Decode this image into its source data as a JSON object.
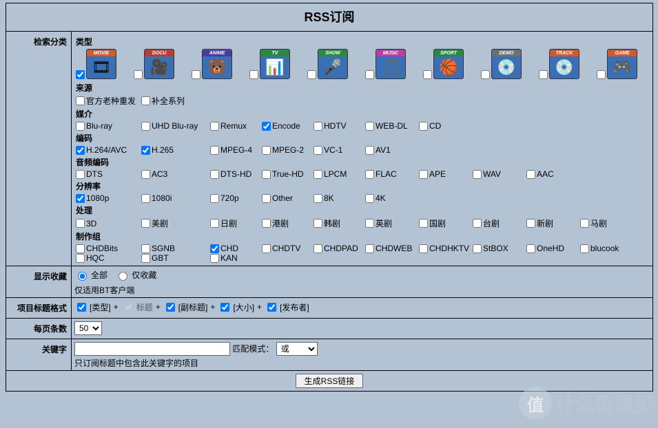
{
  "title": "RSS订阅",
  "labels": {
    "search_category": "检索分类",
    "show_favorites": "显示收藏",
    "title_format": "项目标题格式",
    "per_page": "每页条数",
    "keyword": "关键字"
  },
  "sections": {
    "type": "类型",
    "source": "来源",
    "medium": "媒介",
    "codec": "编码",
    "audio_codec": "音频编码",
    "resolution": "分辨率",
    "processing": "处理",
    "team": "制作组"
  },
  "type_icons": [
    {
      "name": "movie",
      "label": "MOVIE",
      "bg": "#3b6fb5",
      "top": "#d45a2a",
      "glyph": "🎞",
      "checked": true
    },
    {
      "name": "docu",
      "label": "DOCU",
      "bg": "#3b6fb5",
      "top": "#c13a2b",
      "glyph": "🎥",
      "gcolor": "#c13a2b",
      "checked": false
    },
    {
      "name": "anime",
      "label": "ANIME",
      "bg": "#3b6fb5",
      "top": "#4a3aa0",
      "glyph": "🐻",
      "gcolor": "#e6a53a",
      "checked": false
    },
    {
      "name": "tv",
      "label": "TV",
      "bg": "#3b6fb5",
      "top": "#2a8a3a",
      "glyph": "📊",
      "gcolor": "#2a8a3a",
      "checked": false
    },
    {
      "name": "show",
      "label": "SHOW",
      "bg": "#3b6fb5",
      "top": "#2a8a3a",
      "glyph": "🎤",
      "checked": false
    },
    {
      "name": "music",
      "label": "MUSIC",
      "bg": "#3b6fb5",
      "top": "#c43aa0",
      "glyph": "🎵",
      "gcolor": "#c43aa0",
      "checked": false
    },
    {
      "name": "sport",
      "label": "SPORT",
      "bg": "#3b6fb5",
      "top": "#2a8a3a",
      "glyph": "🏀",
      "gcolor": "#2a8a3a",
      "checked": false
    },
    {
      "name": "demo",
      "label": "DEMO",
      "bg": "#3b6fb5",
      "top": "#707070",
      "glyph": "💿",
      "checked": false
    },
    {
      "name": "track",
      "label": "TRACK",
      "bg": "#3b6fb5",
      "top": "#d45a2a",
      "glyph": "💿",
      "checked": false
    },
    {
      "name": "game",
      "label": "GAME",
      "bg": "#3b6fb5",
      "top": "#d45a2a",
      "glyph": "🎮",
      "gcolor": "#e6a53a",
      "checked": false
    }
  ],
  "source_items": [
    {
      "label": "官方老种重发",
      "checked": false
    },
    {
      "label": "补全系列",
      "checked": false
    }
  ],
  "medium_items": [
    {
      "label": "Blu-ray",
      "checked": false
    },
    {
      "label": "UHD Blu-ray",
      "checked": false
    },
    {
      "label": "Remux",
      "checked": false
    },
    {
      "label": "Encode",
      "checked": true
    },
    {
      "label": "HDTV",
      "checked": false
    },
    {
      "label": "WEB-DL",
      "checked": false
    },
    {
      "label": "CD",
      "checked": false
    }
  ],
  "codec_items": [
    {
      "label": "H.264/AVC",
      "checked": true
    },
    {
      "label": "H.265",
      "checked": true
    },
    {
      "label": "MPEG-4",
      "checked": false
    },
    {
      "label": "MPEG-2",
      "checked": false
    },
    {
      "label": "VC-1",
      "checked": false
    },
    {
      "label": "AV1",
      "checked": false
    }
  ],
  "audio_items": [
    {
      "label": "DTS",
      "checked": false
    },
    {
      "label": "AC3",
      "checked": false
    },
    {
      "label": "DTS-HD",
      "checked": false
    },
    {
      "label": "True-HD",
      "checked": false
    },
    {
      "label": "LPCM",
      "checked": false
    },
    {
      "label": "FLAC",
      "checked": false
    },
    {
      "label": "APE",
      "checked": false
    },
    {
      "label": "WAV",
      "checked": false
    },
    {
      "label": "AAC",
      "checked": false
    }
  ],
  "resolution_items": [
    {
      "label": "1080p",
      "checked": true
    },
    {
      "label": "1080i",
      "checked": false
    },
    {
      "label": "720p",
      "checked": false
    },
    {
      "label": "Other",
      "checked": false
    },
    {
      "label": "8K",
      "checked": false
    },
    {
      "label": "4K",
      "checked": false
    }
  ],
  "processing_items": [
    {
      "label": "3D",
      "checked": false
    },
    {
      "label": "美剧",
      "checked": false
    },
    {
      "label": "日剧",
      "checked": false
    },
    {
      "label": "港剧",
      "checked": false
    },
    {
      "label": "韩剧",
      "checked": false
    },
    {
      "label": "英剧",
      "checked": false
    },
    {
      "label": "国剧",
      "checked": false
    },
    {
      "label": "台剧",
      "checked": false
    },
    {
      "label": "新剧",
      "checked": false
    },
    {
      "label": "马剧",
      "checked": false
    }
  ],
  "team_items": [
    {
      "label": "CHDBits",
      "checked": false
    },
    {
      "label": "SGNB",
      "checked": false
    },
    {
      "label": "CHD",
      "checked": true
    },
    {
      "label": "CHDTV",
      "checked": false
    },
    {
      "label": "CHDPAD",
      "checked": false
    },
    {
      "label": "CHDWEB",
      "checked": false
    },
    {
      "label": "CHDHKTV",
      "checked": false
    },
    {
      "label": "StBOX",
      "checked": false
    },
    {
      "label": "OneHD",
      "checked": false
    },
    {
      "label": "blucook",
      "checked": false
    },
    {
      "label": "HQC",
      "checked": false
    },
    {
      "label": "GBT",
      "checked": false
    },
    {
      "label": "KAN",
      "checked": false
    }
  ],
  "favorites": {
    "all": "全部",
    "only": "仅收藏",
    "note": "仅适用BT客户端"
  },
  "title_format": {
    "type": {
      "label": "[类型]",
      "checked": true,
      "disabled": false
    },
    "title": {
      "label": "标题",
      "checked": true,
      "disabled": true
    },
    "subtitle": {
      "label": "[副标题]",
      "checked": true,
      "disabled": false
    },
    "size": {
      "label": "[大小]",
      "checked": true,
      "disabled": false
    },
    "publisher": {
      "label": "[发布者]",
      "checked": true,
      "disabled": false
    },
    "plus": "+"
  },
  "per_page_value": "50",
  "keyword": {
    "match_label": "匹配模式：",
    "match_value": "或",
    "note": "只订阅标题中包含此关键字的项目"
  },
  "submit_label": "生成RSS链接",
  "watermark": {
    "text": "什么值得买",
    "coin": "值"
  }
}
